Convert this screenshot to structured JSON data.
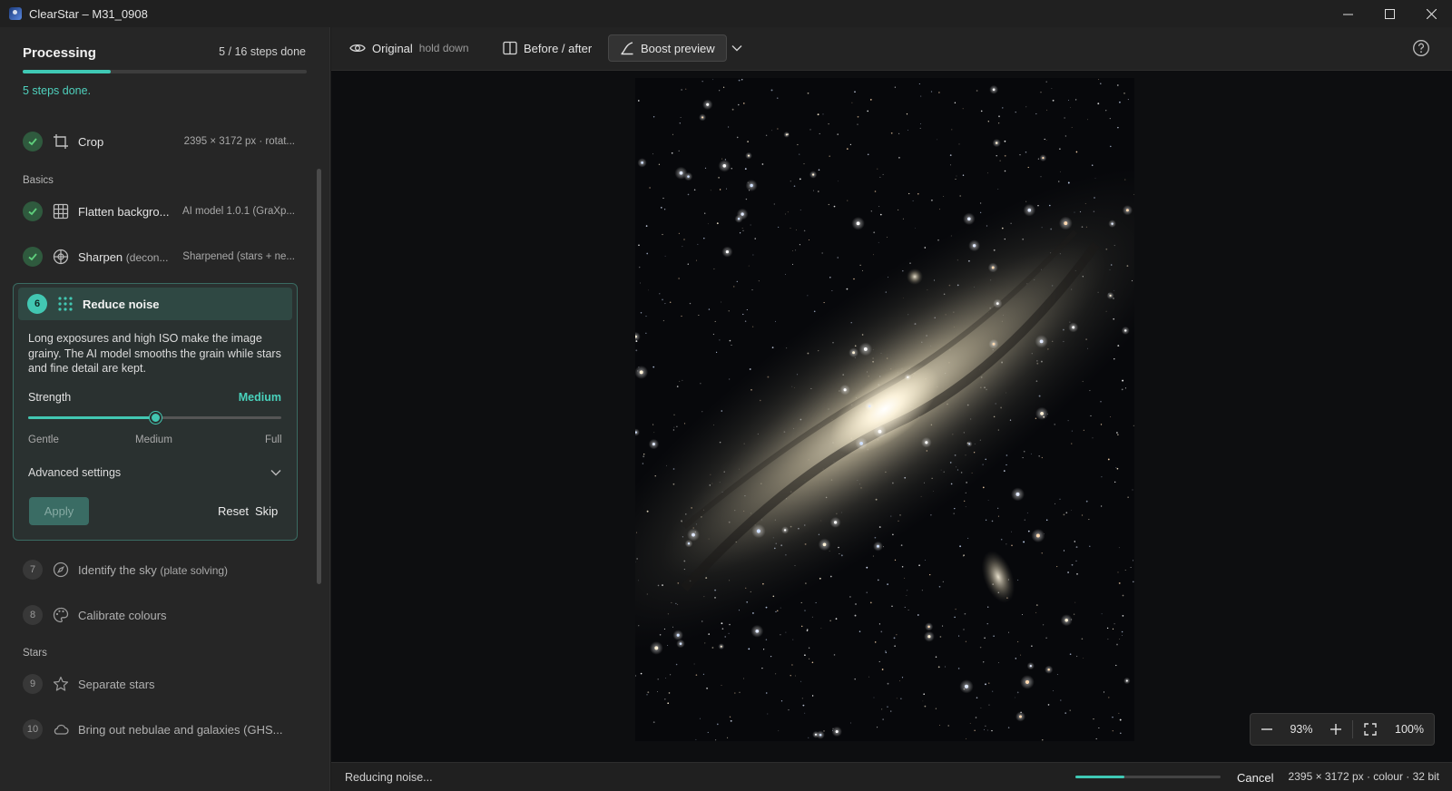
{
  "window": {
    "title": "ClearStar – M31_0908"
  },
  "sidebar": {
    "title": "Processing",
    "steps_count": "5 / 16 steps done",
    "progress": 0.31,
    "status": "5 steps done.",
    "sections": {
      "basics": "Basics",
      "stars": "Stars"
    },
    "done_steps": [
      {
        "name": "Crop",
        "detail": "2395 × 3172 px · rotat..."
      },
      {
        "name": "Flatten backgro...",
        "detail": "AI model 1.0.1 (GraXp..."
      },
      {
        "name": "Sharpen",
        "name_sub": "(decon...",
        "detail": "Sharpened (stars + ne..."
      }
    ],
    "active_step": {
      "number": "6",
      "name": "Reduce noise",
      "description": "Long exposures and high ISO make the image grainy. The AI model smooths the grain while stars and fine detail are kept.",
      "strength_label": "Strength",
      "strength_value": "Medium",
      "slider_level": 0.5,
      "ticks": [
        "Gentle",
        "Medium",
        "Full"
      ],
      "advanced_label": "Advanced settings",
      "apply_label": "Apply",
      "reset_label": "Reset",
      "skip_label": "Skip"
    },
    "pending_steps": [
      {
        "number": "7",
        "name": "Identify the sky",
        "name_sub": "(plate solving)"
      },
      {
        "number": "8",
        "name": "Calibrate colours"
      },
      {
        "number": "9",
        "name": "Separate stars"
      },
      {
        "number": "10",
        "name": "Bring out nebulae and galaxies (GHS..."
      }
    ]
  },
  "toolbar": {
    "original_label": "Original",
    "original_hint": "hold down",
    "before_after_label": "Before / after",
    "boost_label": "Boost preview"
  },
  "zoom": {
    "value": "93%",
    "actual": "100%"
  },
  "status": {
    "text": "Reducing noise...",
    "progress": 0.34,
    "cancel_label": "Cancel",
    "image_info": "2395 × 3172 px · colour · 32 bit"
  },
  "colors": {
    "accent": "#42c7b2",
    "done": "#5fcf7d"
  }
}
